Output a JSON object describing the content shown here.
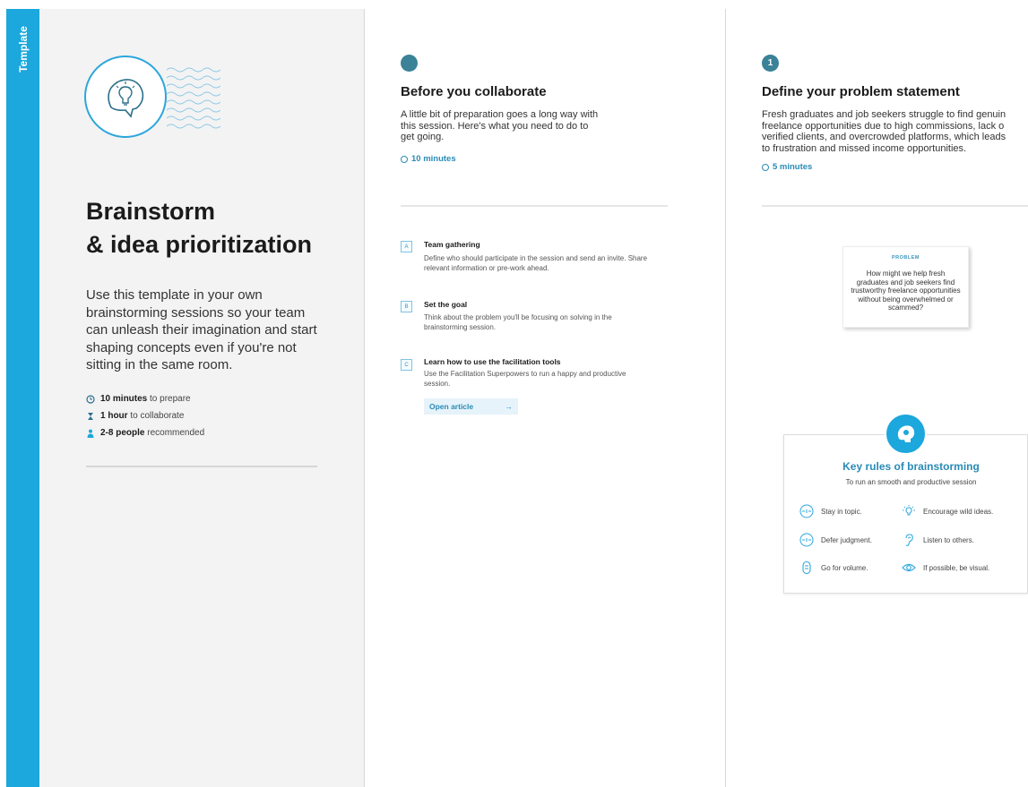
{
  "sidebar": {
    "label": "Template"
  },
  "intro": {
    "title_line1": "Brainstorm",
    "title_line2": "& idea prioritization",
    "description": "Use this template in your own brainstorming sessions so your team can unleash their imagination and start shaping concepts even if you're not sitting in the same room.",
    "meta": [
      {
        "icon": "clock-icon",
        "bold": "10 minutes",
        "text": "to prepare"
      },
      {
        "icon": "hourglass-icon",
        "bold": "1 hour",
        "text": "to collaborate"
      },
      {
        "icon": "person-icon",
        "bold": "2-8 people",
        "text": "recommended"
      }
    ]
  },
  "before": {
    "title": "Before you collaborate",
    "text": "A little bit of preparation goes a long way with this session. Here's what you need to do to get going.",
    "time": "10 minutes",
    "steps": [
      {
        "badge": "A",
        "title": "Team gathering",
        "text": "Define who should participate in the session and send an invite. Share relevant information or pre-work ahead."
      },
      {
        "badge": "B",
        "title": "Set the goal",
        "text": "Think about the problem you'll be focusing on solving in the brainstorming session."
      },
      {
        "badge": "C",
        "title": "Learn how to use the facilitation tools",
        "text": "Use the Facilitation Superpowers to run a happy and productive session."
      }
    ],
    "open_article": "Open article",
    "open_article_arrow": "→"
  },
  "define": {
    "number": "1",
    "title": "Define your problem statement",
    "text_lines": [
      "Fresh graduates and job seekers struggle to find genuin",
      "freelance opportunities due to high commissions, lack o",
      "verified clients, and overcrowded platforms, which leads",
      "to frustration and missed income opportunities."
    ],
    "time": "5 minutes",
    "sticky_label": "PROBLEM",
    "sticky_text": "How might we help fresh graduates and job seekers find trustworthy freelance opportunities without being overwhelmed or scammed?"
  },
  "rules": {
    "title": "Key rules of brainstorming",
    "subtitle": "To run an smooth and productive session",
    "items": [
      {
        "icon": "target-icon",
        "label": "Stay in topic."
      },
      {
        "icon": "lightbulb-icon",
        "label": "Encourage wild ideas."
      },
      {
        "icon": "target-icon",
        "label": "Defer judgment."
      },
      {
        "icon": "ear-icon",
        "label": "Listen to others."
      },
      {
        "icon": "stack-icon",
        "label": "Go for volume."
      },
      {
        "icon": "eye-icon",
        "label": "If possible, be visual."
      }
    ]
  },
  "colors": {
    "accent": "#1ca7dd",
    "teal_dot": "#3a8297",
    "link": "#2a8bb6",
    "panel_gray": "#f3f3f3"
  }
}
